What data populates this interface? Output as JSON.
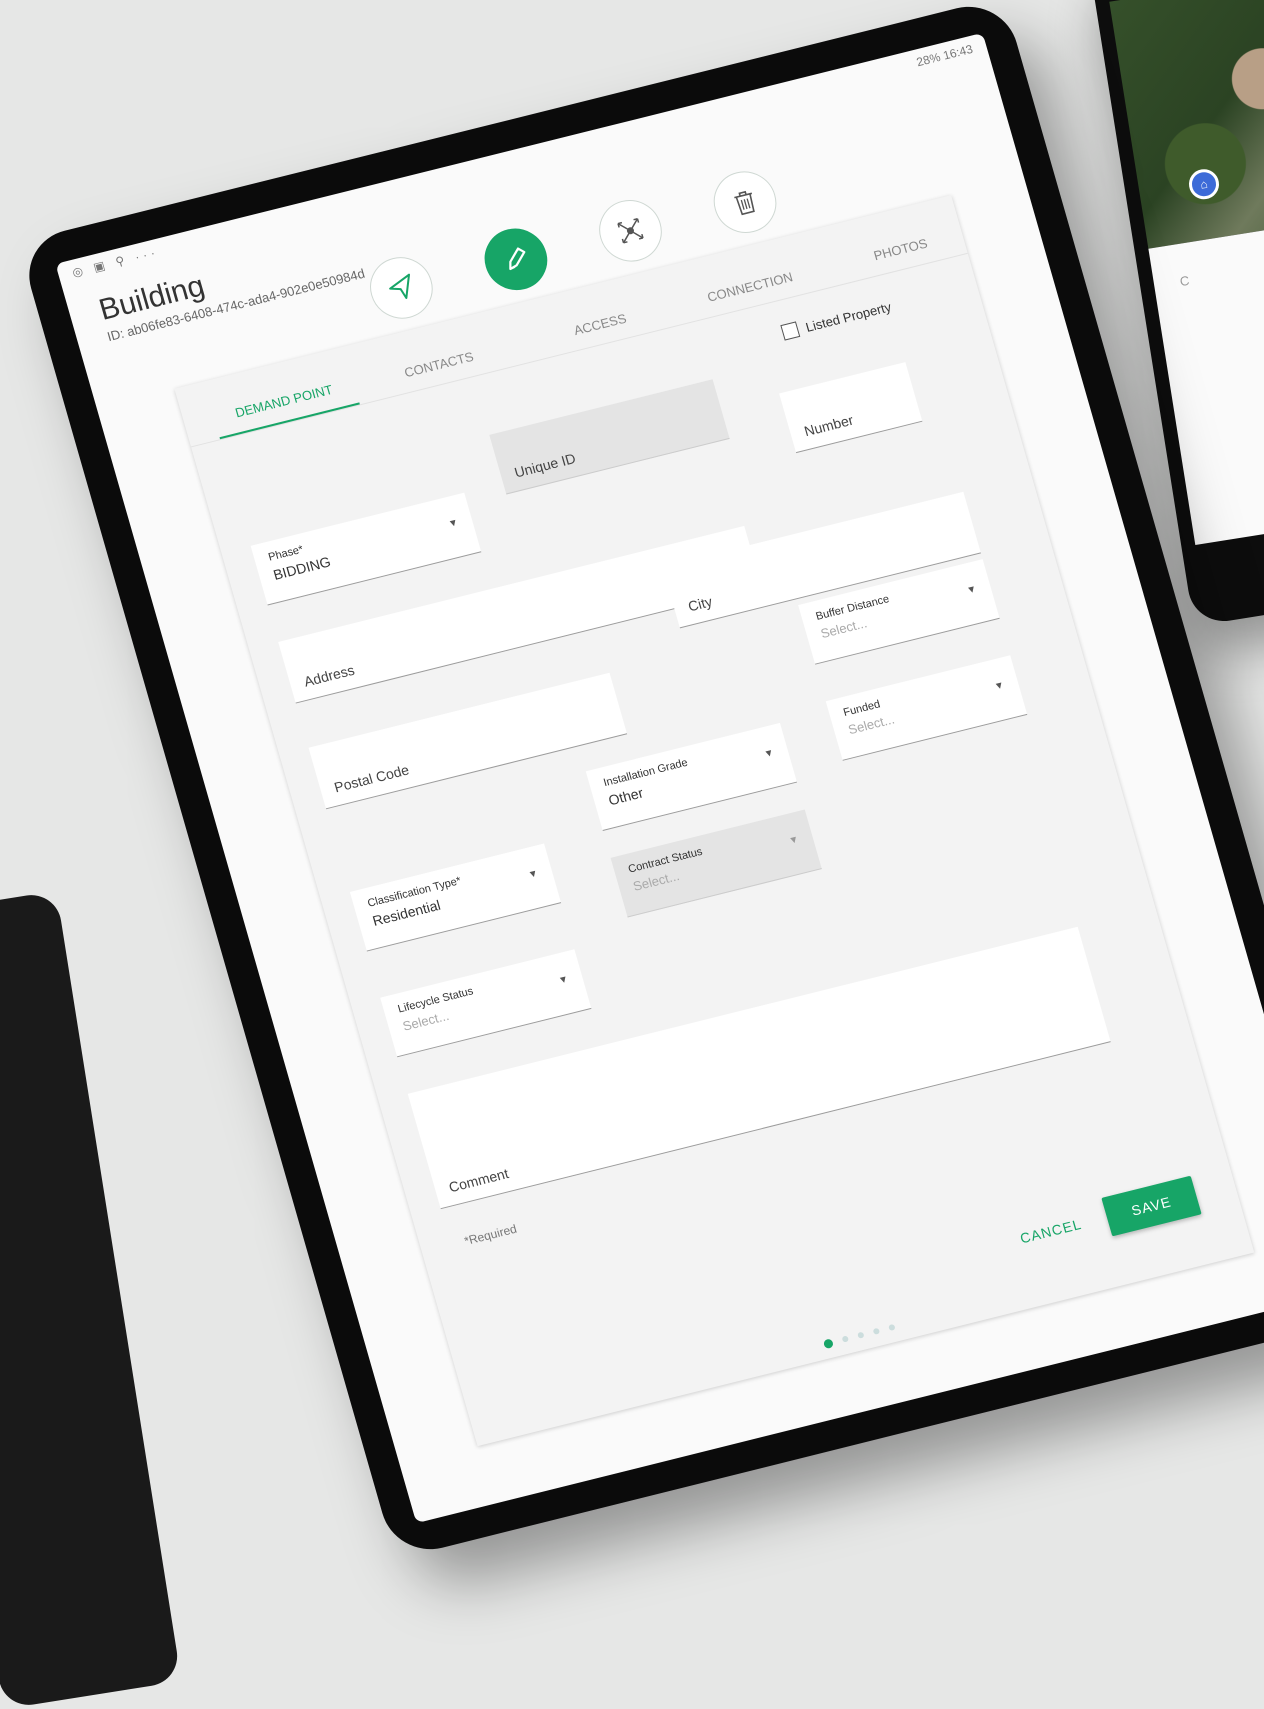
{
  "status_bar": {
    "left_icons": "◎ ▣ ⚲ ···",
    "right": "28% 16:43"
  },
  "header": {
    "title": "Building",
    "id_text": "ID: ab06fe83-6408-474c-ada4-902e0e50984d"
  },
  "actions": [
    {
      "label": "GO TO",
      "icon": "navigation-arrow-icon"
    },
    {
      "label": "EDIT",
      "icon": "pencil-icon"
    },
    {
      "label": "MOVE",
      "icon": "move-icon"
    },
    {
      "label": "DELETE",
      "icon": "trash-icon"
    }
  ],
  "tabs": [
    "DEMAND POINT",
    "CONTACTS",
    "ACCESS",
    "CONNECTION",
    "PHOTOS"
  ],
  "form": {
    "listed_property": "Listed Property",
    "phase": {
      "label": "Phase*",
      "value": "BIDDING"
    },
    "unique_id": "Unique ID",
    "number": "Number",
    "address": "Address",
    "city": "City",
    "postal_code": "Postal Code",
    "buffer_distance": {
      "label": "Buffer Distance",
      "placeholder": "Select..."
    },
    "installation_grade": {
      "label": "Installation Grade",
      "value": "Other"
    },
    "classification_type": {
      "label": "Classification Type*",
      "value": "Residential"
    },
    "funded": {
      "label": "Funded",
      "placeholder": "Select..."
    },
    "contract_status": {
      "label": "Contract Status",
      "placeholder": "Select..."
    },
    "lifecycle_status": {
      "label": "Lifecycle Status",
      "placeholder": "Select..."
    },
    "comment": "Comment",
    "required_note": "*Required"
  },
  "buttons": {
    "cancel": "CANCEL",
    "save": "SAVE"
  },
  "colors": {
    "accent": "#17a567"
  }
}
